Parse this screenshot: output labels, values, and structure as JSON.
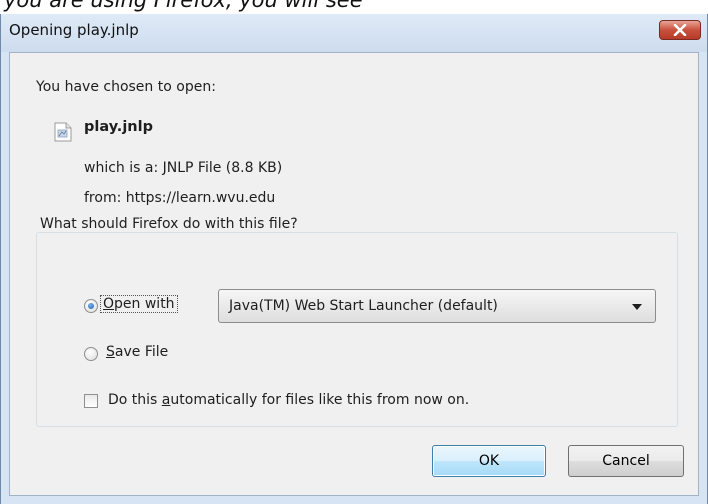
{
  "top_partial_text": "you are using Firefox, you will see",
  "dialog": {
    "title": "Opening play.jnlp",
    "close_glyph": "×",
    "prompt": "You have chosen to open:",
    "file": {
      "icon": "jnlp-file-icon",
      "name": "play.jnlp",
      "which_is_a": "which is a:  JNLP File (8.8 KB)",
      "from": "from:  https://learn.wvu.edu"
    },
    "group_label": "What should Firefox do with this file?",
    "open_with": {
      "label_accel": "O",
      "label_rest": "pen with",
      "selected": true,
      "app": "Java(TM) Web Start Launcher (default)"
    },
    "save_file": {
      "label_accel": "S",
      "label_rest": "ave File",
      "selected": false
    },
    "auto_checkbox": {
      "label_pre": "Do this ",
      "label_accel": "a",
      "label_post": "utomatically for files like this from now on.",
      "checked": false
    },
    "buttons": {
      "ok": "OK",
      "cancel": "Cancel"
    }
  },
  "colors": {
    "frame": "#d6e4f3",
    "client": "#f0f0f0",
    "close_button": "#c9503e",
    "ok_button": "#bee6fd"
  }
}
